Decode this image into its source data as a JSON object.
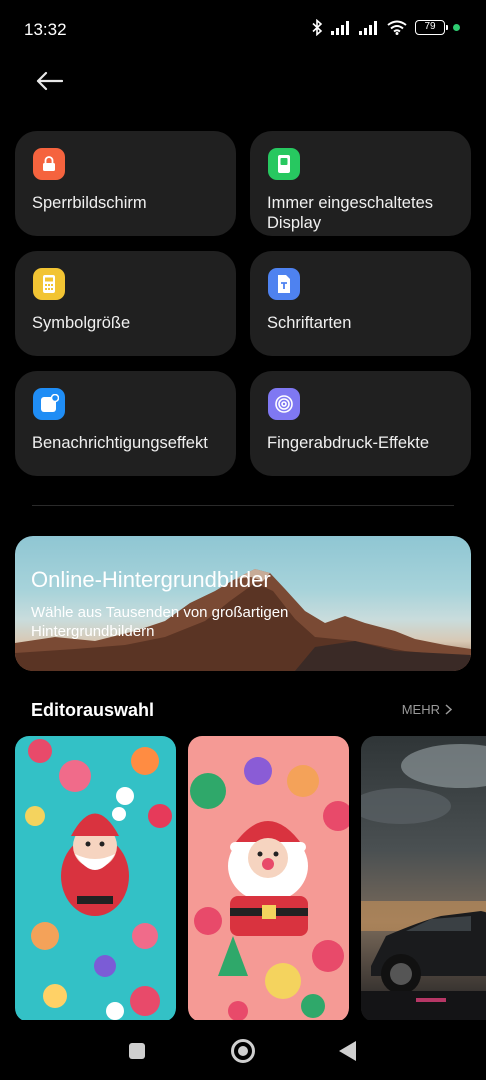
{
  "status_bar": {
    "time": "13:32",
    "battery": "79"
  },
  "tiles": [
    {
      "label": "Sperrbildschirm",
      "icon": "lock-icon",
      "color": "#f5633e"
    },
    {
      "label": "Immer eingeschaltetes Display",
      "icon": "phone-display-icon",
      "color": "#27c860"
    },
    {
      "label": "Symbolgröße",
      "icon": "calculator-icon",
      "color": "#f2c433"
    },
    {
      "label": "Schriftarten",
      "icon": "font-file-icon",
      "color": "#4e82f0"
    },
    {
      "label": "Benachrichtigungseffekt",
      "icon": "notification-icon",
      "color": "#1f8df5"
    },
    {
      "label": "Fingerabdruck-Effekte",
      "icon": "fingerprint-icon",
      "color": "#7f78f2"
    }
  ],
  "banner": {
    "title": "Online-Hintergrundbilder",
    "subtitle": "Wähle aus Tausenden von großartigen Hintergrundbildern"
  },
  "section": {
    "title": "Editorauswahl",
    "more": "MEHR"
  }
}
